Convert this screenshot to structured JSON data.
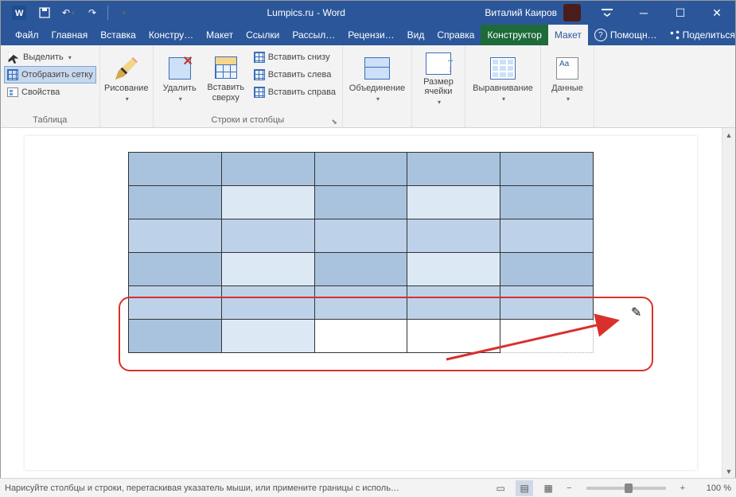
{
  "title": {
    "app": "Lumpics.ru",
    "suffix": " -  Word"
  },
  "user": {
    "name": "Виталий Каиров"
  },
  "tabs": {
    "file": "Файл",
    "home": "Главная",
    "insert": "Вставка",
    "design": "Констру…",
    "layout": "Макет",
    "references": "Ссылки",
    "mailings": "Рассыл…",
    "review": "Рецензи…",
    "view": "Вид",
    "help_tab": "Справка",
    "constructor": "Конструктор",
    "maket": "Макет",
    "help": "Помощн…",
    "share": "Поделиться"
  },
  "ribbon": {
    "table_group": "Таблица",
    "select": "Выделить",
    "show_grid": "Отобразить сетку",
    "properties": "Свойства",
    "draw_group": "Рисование",
    "draw": "Рисование",
    "delete": "Удалить",
    "insert_above": "Вставить сверху",
    "insert_below": "Вставить снизу",
    "insert_left": "Вставить слева",
    "insert_right": "Вставить справа",
    "rows_cols": "Строки и столбцы",
    "merge": "Объединение",
    "cell_size": "Размер ячейки",
    "alignment": "Выравнивание",
    "data": "Данные"
  },
  "status": {
    "hint": "Нарисуйте столбцы и строки, перетаскивая указатель мыши, или примените границы с исполь…"
  },
  "zoom": {
    "pct": "100 %"
  }
}
